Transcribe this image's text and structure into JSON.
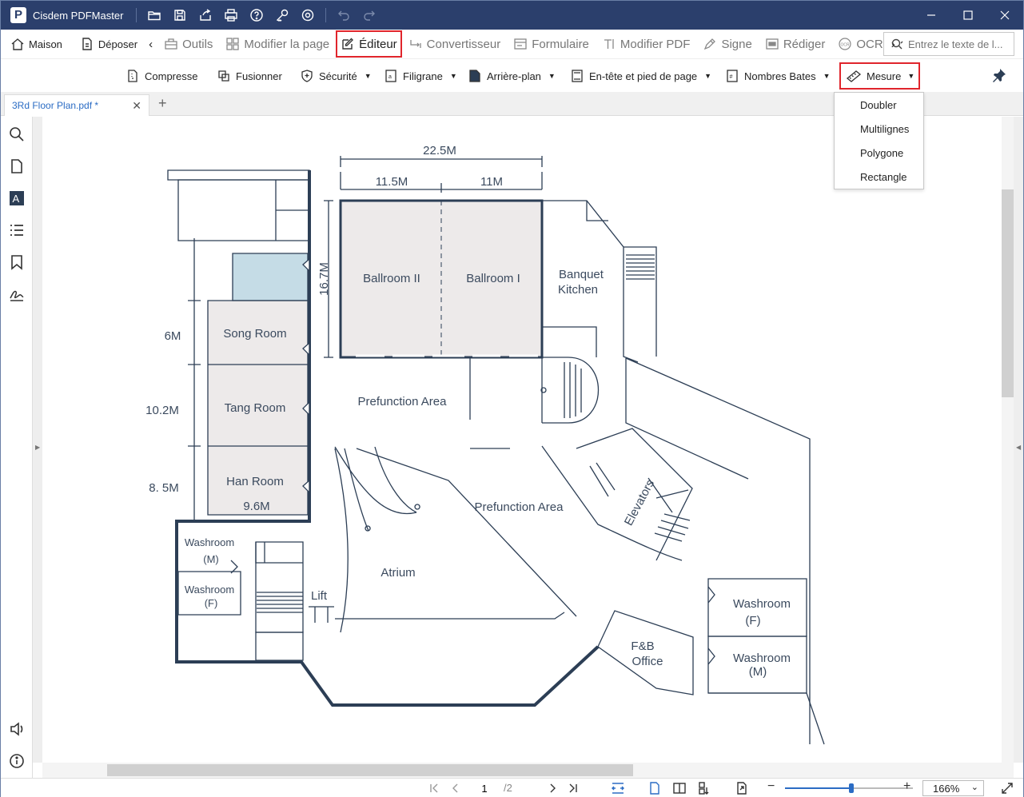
{
  "app": {
    "name": "Cisdem PDFMaster",
    "logo_letter": "P"
  },
  "title_icons": [
    "folder-open-icon",
    "save-icon",
    "share-icon",
    "print-icon",
    "help-icon",
    "key-icon",
    "settings-icon",
    "undo-icon",
    "redo-icon"
  ],
  "toolbar": {
    "home": "Maison",
    "upload": "Déposer",
    "tools": "Outils",
    "modify_page": "Modifier la page",
    "editor": "Éditeur",
    "converter": "Convertisseur",
    "form": "Formulaire",
    "modify_pdf": "Modifier PDF",
    "sign": "Signe",
    "redact": "Rédiger",
    "ocr": "OCR",
    "search_placeholder": "Entrez le texte de l..."
  },
  "subtoolbar": {
    "compress": "Compresse",
    "merge": "Fusionner",
    "security": "Sécurité",
    "watermark": "Filigrane",
    "background": "Arrière-plan",
    "header_footer": "En-tête et pied de page",
    "bates": "Nombres Bates",
    "measure": "Mesure"
  },
  "measure_menu": [
    "Doubler",
    "Multilignes",
    "Polygone",
    "Rectangle"
  ],
  "tab": {
    "title": "3Rd Floor Plan.pdf *",
    "close": "✕",
    "add": "+"
  },
  "floorplan": {
    "dim_total": "22.5M",
    "dim_left": "11.5M",
    "dim_right": "11M",
    "dim_height": "16.7M",
    "ballroom2": "Ballroom II",
    "ballroom1": "Ballroom I",
    "banquet_1": "Banquet",
    "banquet_2": "Kitchen",
    "dim_6m": "6M",
    "dim_102m": "10.2M",
    "dim_85m": "8. 5M",
    "song_room": "Song Room",
    "tang_room": "Tang Room",
    "han_room": "Han Room",
    "dim_96m": "9.6M",
    "prefunction_top": "Prefunction Area",
    "prefunction_mid": "Prefunction Area",
    "elevators": "Elevators",
    "atrium": "Atrium",
    "lift": "Lift",
    "washroom_m_left_1": "Washroom",
    "washroom_m_left_2": "(M)",
    "washroom_f_left_1": "Washroom",
    "washroom_f_left_2": "(F)",
    "fb_1": "F&B",
    "fb_2": "Office",
    "washroom_f_right_1": "Washroom",
    "washroom_f_right_2": "(F)",
    "washroom_m_right_1": "Washroom",
    "washroom_m_right_2": "(M)"
  },
  "status": {
    "current_page": "1",
    "total_pages": "/2",
    "zoom": "166%",
    "zoom_level_fraction": 0.53
  },
  "colors": {
    "titlebar": "#2b3f6c",
    "highlight": "#e0252c",
    "accent": "#2b6cc4",
    "wall": "#2c3e55",
    "room_fill": "#edeaea",
    "blue_room": "#c5dce6"
  }
}
